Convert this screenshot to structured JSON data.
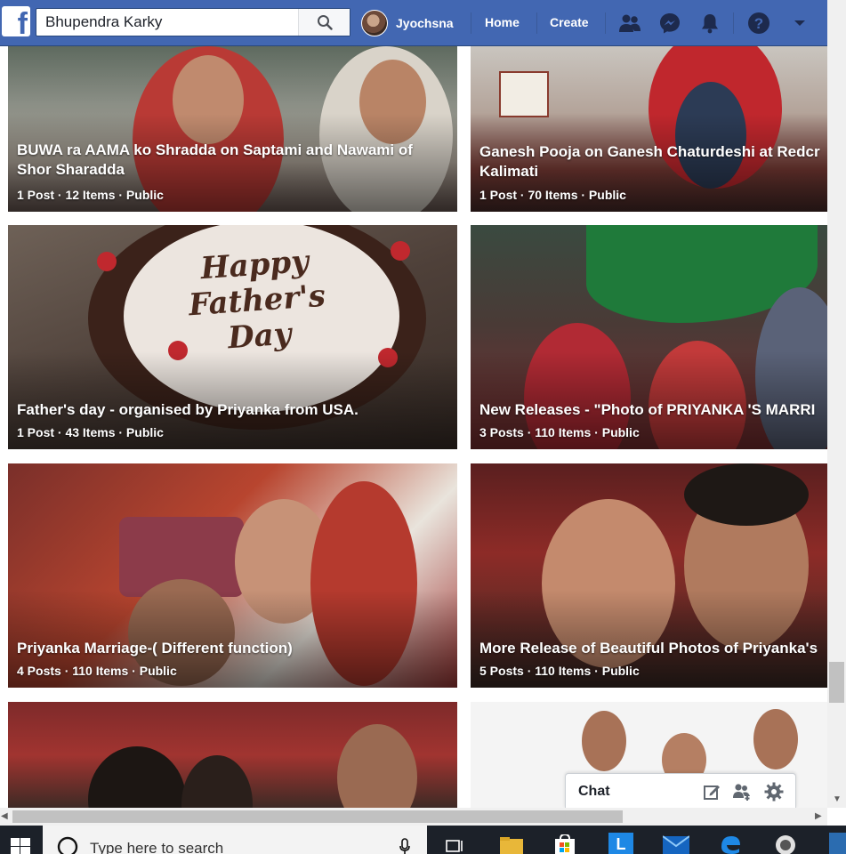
{
  "topbar": {
    "search_value": "Bhupendra Karky",
    "profile_name": "Jyochsna",
    "nav_home": "Home",
    "nav_create": "Create",
    "brand_color": "#4267b2",
    "icons": [
      "facebook-logo",
      "search-icon",
      "friends-icon",
      "messenger-icon",
      "notifications-icon",
      "help-icon",
      "dropdown-icon"
    ]
  },
  "albums": [
    {
      "title": "BUWA ra AAMA ko Shradda on Saptami and Nawami of Shor Sharadda",
      "meta": "1 Post · 12 Items · Public"
    },
    {
      "title": "Ganesh Pooja on Ganesh Chaturdeshi at Redcr",
      "title_line2": "Kalimati",
      "meta": "1 Post · 70 Items · Public"
    },
    {
      "title": "Father's day - organised by Priyanka from USA.",
      "meta": "1 Post · 43 Items · Public",
      "cake_text": "Happy Father's Day"
    },
    {
      "title": "New Releases - \"Photo of PRIYANKA 'S MARRI",
      "meta": "3 Posts · 110 Items · Public"
    },
    {
      "title": "Priyanka Marriage-( Different function)",
      "meta": "4 Posts · 110 Items · Public"
    },
    {
      "title": "More Release of Beautiful Photos of Priyanka's",
      "meta": "5 Posts · 110 Items · Public"
    }
  ],
  "chat": {
    "label": "Chat",
    "icons": [
      "compose-icon",
      "new-group-icon",
      "settings-gear-icon"
    ]
  },
  "taskbar": {
    "search_placeholder": "Type here to search",
    "icons": [
      "windows-start-icon",
      "microphone-icon",
      "task-view-icon",
      "file-explorer-icon",
      "store-icon",
      "app-l-icon",
      "mail-icon",
      "edge-icon",
      "app-round-icon",
      "app-edge-icon"
    ]
  }
}
